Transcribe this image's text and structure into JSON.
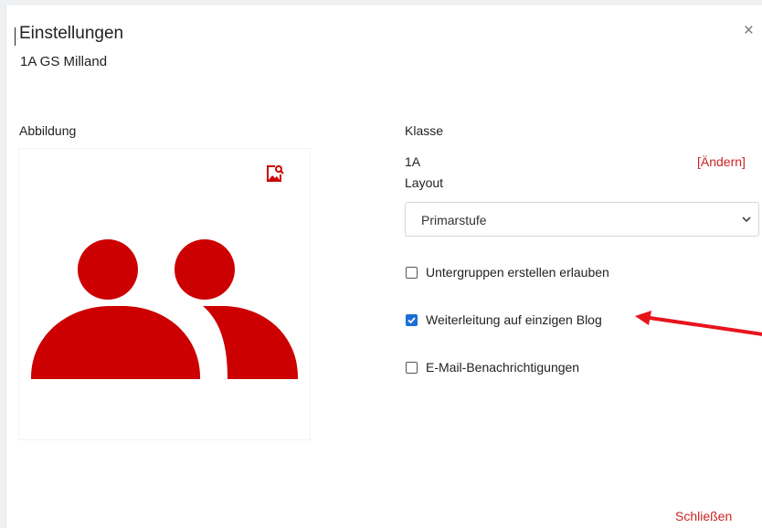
{
  "dialog": {
    "title": "Einstellungen",
    "subtitle": "1A GS Milland",
    "close_symbol": "×",
    "close_icon": "close-icon",
    "footer_close_label": "Schließen"
  },
  "image_section": {
    "label": "Abbildung",
    "edit_icon": "image-edit-icon",
    "placeholder_icon": "users-icon",
    "icon_color": "#cc0000"
  },
  "klasse": {
    "label": "Klasse",
    "value": "1A",
    "change_label": "[Ändern]"
  },
  "layout": {
    "label": "Layout",
    "selected": "Primarstufe"
  },
  "options": [
    {
      "label": "Untergruppen erstellen erlauben",
      "checked": false
    },
    {
      "label": "Weiterleitung auf einzigen Blog",
      "checked": true
    },
    {
      "label": "E-Mail-Benachrichtigungen",
      "checked": false
    }
  ],
  "colors": {
    "accent": "#cc2222",
    "checkbox_checked": "#1a6fd6",
    "annotation_arrow": "#e8141c"
  }
}
